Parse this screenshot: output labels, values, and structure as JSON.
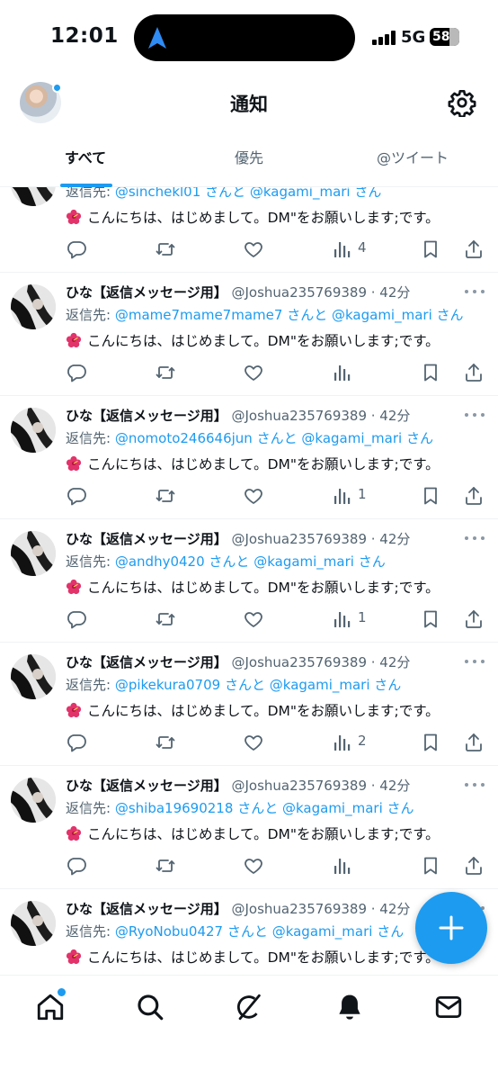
{
  "status_bar": {
    "time": "12:01",
    "network": "5G",
    "battery": "58"
  },
  "header": {
    "title": "通知"
  },
  "tabs": [
    {
      "label": "すべて",
      "active": true
    },
    {
      "label": "優先",
      "active": false
    },
    {
      "label": "@ツイート",
      "active": false
    }
  ],
  "notifications": [
    {
      "partial": true,
      "reply_label": "返信先:",
      "reply_mention": "@sinchekl01",
      "reply_mid": "さんと",
      "reply_mention2": "@kagami_mari",
      "reply_tail": "さん",
      "text": "こんにちは、はじめまして。DM\"をお願いします;です。",
      "views": "4"
    },
    {
      "name": "ひな【返信メッセージ用】",
      "handle": "@Joshua235769389 · 42分",
      "reply_label": "返信先:",
      "reply_mention": "@mame7mame7mame7",
      "reply_mid": "さんと",
      "reply_mention2": "@kagami_mari",
      "reply_tail": "さん",
      "text": "こんにちは、はじめまして。DM\"をお願いします;です。",
      "views": ""
    },
    {
      "name": "ひな【返信メッセージ用】",
      "handle": "@Joshua235769389 · 42分",
      "reply_label": "返信先:",
      "reply_mention": "@nomoto246646jun",
      "reply_mid": "さんと",
      "reply_mention2": "@kagami_mari",
      "reply_tail": "さん",
      "text": "こんにちは、はじめまして。DM\"をお願いします;です。",
      "views": "1"
    },
    {
      "name": "ひな【返信メッセージ用】",
      "handle": "@Joshua235769389 · 42分",
      "reply_label": "返信先:",
      "reply_mention": "@andhy0420",
      "reply_mid": "さんと",
      "reply_mention2": "@kagami_mari",
      "reply_tail": "さん",
      "text": "こんにちは、はじめまして。DM\"をお願いします;です。",
      "views": "1"
    },
    {
      "name": "ひな【返信メッセージ用】",
      "handle": "@Joshua235769389 · 42分",
      "reply_label": "返信先:",
      "reply_mention": "@pikekura0709",
      "reply_mid": "さんと",
      "reply_mention2": "@kagami_mari",
      "reply_tail": "さん",
      "text": "こんにちは、はじめまして。DM\"をお願いします;です。",
      "views": "2"
    },
    {
      "name": "ひな【返信メッセージ用】",
      "handle": "@Joshua235769389 · 42分",
      "reply_label": "返信先:",
      "reply_mention": "@shiba19690218",
      "reply_mid": "さんと",
      "reply_mention2": "@kagami_mari",
      "reply_tail": "さん",
      "text": "こんにちは、はじめまして。DM\"をお願いします;です。",
      "views": ""
    },
    {
      "name": "ひな【返信メッセージ用】",
      "handle": "@Joshua235769389 · 42分",
      "reply_label": "返信先:",
      "reply_mention": "@RyoNobu0427",
      "reply_mid": "さんと",
      "reply_mention2": "@kagami_mari",
      "reply_tail": "さん",
      "text": "こんにちは、はじめまして。DM\"をお願いします;です。",
      "views": ""
    }
  ],
  "colors": {
    "accent": "#1d9bf0",
    "text": "#0f1419",
    "secondary": "#536471",
    "divider": "#eff3f4"
  },
  "icons": [
    "navigation-arrow-icon",
    "gear-icon",
    "reply-icon",
    "retweet-icon",
    "like-icon",
    "views-icon",
    "bookmark-icon",
    "share-icon",
    "compose-plus-icon",
    "home-icon",
    "search-icon",
    "grok-icon",
    "bell-icon",
    "mail-icon"
  ]
}
